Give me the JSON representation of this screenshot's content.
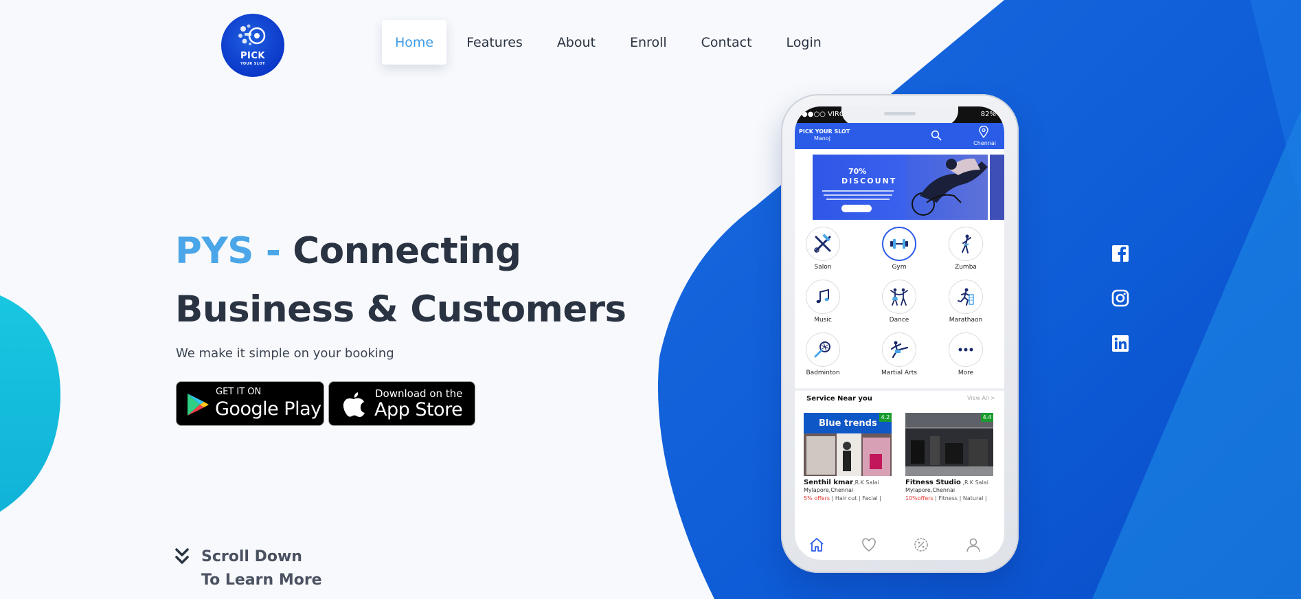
{
  "brand": {
    "logo_line1": "PICK",
    "logo_line2": "YOUR SLOT"
  },
  "nav": {
    "items": [
      {
        "label": "Home",
        "active": true
      },
      {
        "label": "Features"
      },
      {
        "label": "About"
      },
      {
        "label": "Enroll"
      },
      {
        "label": "Contact"
      },
      {
        "label": "Login"
      }
    ]
  },
  "hero": {
    "title_accent": "PYS - ",
    "title_line1": "Connecting",
    "title_line2": "Business & Customers",
    "subtitle": "We make it simple on your booking",
    "google_play": {
      "small": "GET IT ON",
      "big": "Google Play"
    },
    "app_store": {
      "small": "Download on the",
      "big": "App Store"
    },
    "scroll_line1": "Scroll Down",
    "scroll_line2": "To Learn More"
  },
  "social": [
    {
      "icon": "facebook-icon"
    },
    {
      "icon": "instagram-icon"
    },
    {
      "icon": "linkedin-icon"
    }
  ],
  "phone": {
    "carrier": "●●○○ VIRGIN",
    "battery": "82%",
    "app_title": "PICK YOUR SLOT",
    "user": "Manoj",
    "location": "Chennai",
    "banner": {
      "line1": "70%",
      "line2": "DISCOUNT"
    },
    "categories": [
      {
        "label": "Salon",
        "icon": "salon-icon"
      },
      {
        "label": "Gym",
        "icon": "dumbbell-icon",
        "selected": true
      },
      {
        "label": "Zumba",
        "icon": "zumba-icon"
      },
      {
        "label": "Music",
        "icon": "music-icon"
      },
      {
        "label": "Dance",
        "icon": "dance-icon"
      },
      {
        "label": "Marathaon",
        "icon": "marathon-icon"
      },
      {
        "label": "Badminton",
        "icon": "badminton-icon"
      },
      {
        "label": "Martial Arts",
        "icon": "martial-arts-icon"
      },
      {
        "label": "More",
        "icon": "more-icon"
      }
    ],
    "near_title": "Service Near you",
    "view_all": "View All >",
    "cards": [
      {
        "name": "Senthil kmar",
        "street": ",R.K Salai",
        "area": "Mylapore,Chennai",
        "offer": "5% offers",
        "services": " | Hair cut | Facial |",
        "rating": "4.2",
        "sign": "Blue trends"
      },
      {
        "name": "Fitness Studio",
        "street": " ,R.K Salai",
        "area": "Mylapore,Chennai",
        "offer": "10%offers",
        "services": " | Fitness | Natural |",
        "rating": "4.4"
      }
    ],
    "colors": {
      "primary": "#2a5ce8",
      "accent": "#4aa6e8"
    }
  }
}
